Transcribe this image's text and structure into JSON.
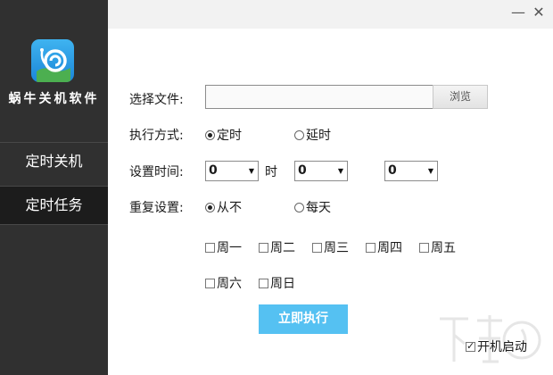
{
  "app": {
    "name": "蜗牛关机软件"
  },
  "sidebar": {
    "items": [
      {
        "label": "定时关机",
        "active": false
      },
      {
        "label": "定时任务",
        "active": true
      }
    ]
  },
  "window": {
    "minimize_glyph": "—",
    "close_glyph": "✕"
  },
  "form": {
    "file_label": "选择文件:",
    "file_value": "",
    "browse_label": "浏览",
    "mode_label": "执行方式:",
    "mode_options": [
      {
        "label": "定时",
        "selected": true
      },
      {
        "label": "延时",
        "selected": false
      }
    ],
    "time_label": "设置时间:",
    "hour_value": "0",
    "hour_unit": "时",
    "minute_value": "0",
    "second_value": "0",
    "repeat_label": "重复设置:",
    "repeat_options": [
      {
        "label": "从不",
        "selected": true
      },
      {
        "label": "每天",
        "selected": false
      }
    ],
    "weekdays": [
      {
        "label": "周一",
        "checked": false
      },
      {
        "label": "周二",
        "checked": false
      },
      {
        "label": "周三",
        "checked": false
      },
      {
        "label": "周四",
        "checked": false
      },
      {
        "label": "周五",
        "checked": false
      },
      {
        "label": "周六",
        "checked": false
      },
      {
        "label": "周日",
        "checked": false
      }
    ],
    "run_label": "立即执行",
    "autostart_label": "开机启动",
    "autostart_checked": true
  },
  "colors": {
    "sidebar_bg": "#303030",
    "sidebar_active": "#1c1c1c",
    "accent": "#55c1f2",
    "logo_blue": "#2a9be6"
  }
}
